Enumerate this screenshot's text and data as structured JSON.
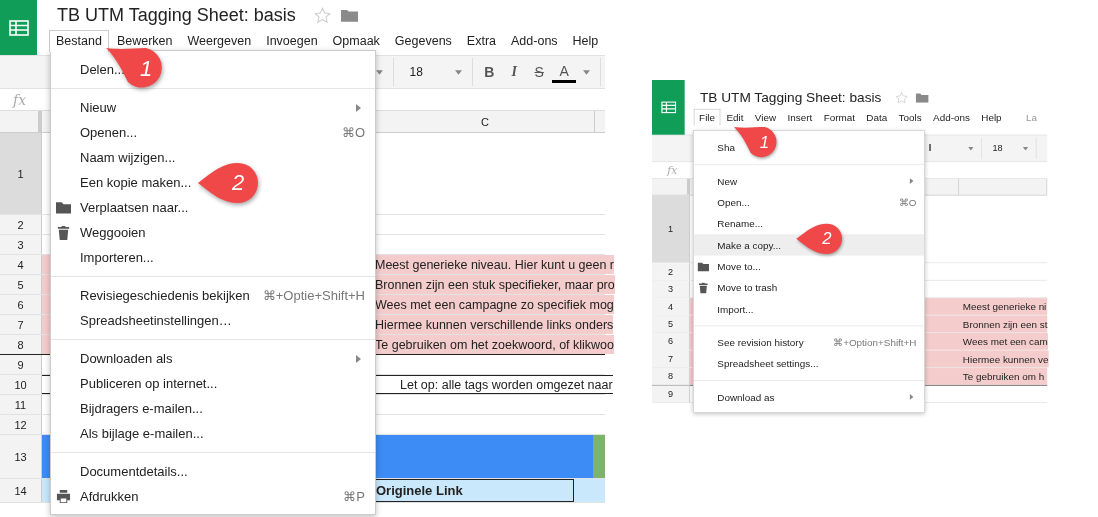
{
  "panels": [
    {
      "title": "TB UTM Tagging Sheet: basis",
      "menus": [
        {
          "label": "Bestand",
          "selected": true
        },
        {
          "label": "Bewerken",
          "selected": false
        },
        {
          "label": "Weergeven",
          "selected": false
        },
        {
          "label": "Invoegen",
          "selected": false
        },
        {
          "label": "Opmaak",
          "selected": false
        },
        {
          "label": "Gegevens",
          "selected": false
        },
        {
          "label": "Extra",
          "selected": false
        },
        {
          "label": "Add-ons",
          "selected": false
        },
        {
          "label": "Help",
          "selected": false
        }
      ],
      "toolbar": {
        "font_size": "18",
        "buttons": [
          "B",
          "I",
          "S",
          "A"
        ]
      },
      "formula_label": "fx",
      "column_label": "C",
      "rows": [
        {
          "number": "1",
          "kind": "blank"
        },
        {
          "number": "2",
          "kind": "blank"
        },
        {
          "number": "3",
          "kind": "blank"
        },
        {
          "number": "4",
          "kind": "pink",
          "text": "Meest generieke niveau. Hier kunt u geen r"
        },
        {
          "number": "5",
          "kind": "pink",
          "text": "Bronnen zijn een stuk specifieker, maar pro"
        },
        {
          "number": "6",
          "kind": "pink",
          "text": "Wees met een campagne zo specifiek mog"
        },
        {
          "number": "7",
          "kind": "pink",
          "text": "Hiermee kunnen verschillende links onders"
        },
        {
          "number": "8",
          "kind": "pink",
          "text": "Te gebruiken om het zoekwoord, of klikwoo"
        },
        {
          "number": "9",
          "kind": "blank"
        },
        {
          "number": "10",
          "kind": "note",
          "text": "Let op: alle tags worden omgezet naar"
        },
        {
          "number": "11",
          "kind": "blank"
        },
        {
          "number": "12",
          "kind": "blank"
        },
        {
          "number": "13",
          "kind": "band"
        },
        {
          "number": "14",
          "kind": "label",
          "text": "Originele Link"
        }
      ],
      "file_menu": [
        [
          {
            "label": "Delen...",
            "kind": "plain",
            "selected": false
          }
        ],
        [
          {
            "label": "Nieuw",
            "kind": "submenu",
            "selected": false
          },
          {
            "label": "Openen...",
            "kind": "plain",
            "shortcut": "⌘O",
            "selected": false
          },
          {
            "label": "Naam wijzigen...",
            "kind": "plain",
            "selected": false
          },
          {
            "label": "Een kopie maken...",
            "kind": "plain",
            "selected": false
          },
          {
            "label": "Verplaatsen naar...",
            "kind": "folder",
            "selected": false
          },
          {
            "label": "Weggooien",
            "kind": "trash",
            "selected": false
          },
          {
            "label": "Importeren...",
            "kind": "plain",
            "selected": false
          }
        ],
        [
          {
            "label": "Revisiegeschiedenis bekijken",
            "kind": "plain",
            "shortcut": "⌘+Optie+Shift+H",
            "selected": false
          },
          {
            "label": "Spreadsheetinstellingen…",
            "kind": "plain",
            "selected": false
          }
        ],
        [
          {
            "label": "Downloaden als",
            "kind": "submenu",
            "selected": false
          },
          {
            "label": "Publiceren op internet...",
            "kind": "plain",
            "selected": false
          },
          {
            "label": "Bijdragers e-mailen...",
            "kind": "plain",
            "selected": false
          },
          {
            "label": "Als bijlage e-mailen...",
            "kind": "plain",
            "selected": false
          }
        ],
        [
          {
            "label": "Documentdetails...",
            "kind": "plain",
            "selected": false
          },
          {
            "label": "Afdrukken",
            "kind": "printer",
            "shortcut": "⌘P",
            "selected": false
          }
        ]
      ],
      "callouts": [
        "1",
        "2"
      ]
    },
    {
      "title": "TB UTM Tagging Sheet: basis",
      "menus": [
        {
          "label": "File",
          "selected": true
        },
        {
          "label": "Edit",
          "selected": false
        },
        {
          "label": "View",
          "selected": false
        },
        {
          "label": "Insert",
          "selected": false
        },
        {
          "label": "Format",
          "selected": false
        },
        {
          "label": "Data",
          "selected": false
        },
        {
          "label": "Tools",
          "selected": false
        },
        {
          "label": "Add-ons",
          "selected": false
        },
        {
          "label": "Help",
          "selected": false
        }
      ],
      "last_edit": "La",
      "toolbar": {
        "font": "l",
        "font_size": "18"
      },
      "formula_label": "fx",
      "rows": [
        {
          "number": "1",
          "kind": "blank"
        },
        {
          "number": "2",
          "kind": "blank"
        },
        {
          "number": "3",
          "kind": "blank"
        },
        {
          "number": "4",
          "kind": "pink",
          "text": "Meest generieke ni"
        },
        {
          "number": "5",
          "kind": "pink",
          "text": "Bronnen zijn een st"
        },
        {
          "number": "6",
          "kind": "pink",
          "text": "Wees met een cam"
        },
        {
          "number": "7",
          "kind": "pink",
          "text": "Hiermee kunnen ve"
        },
        {
          "number": "8",
          "kind": "pink",
          "text": "Te gebruiken om h"
        },
        {
          "number": "9",
          "kind": "blank"
        }
      ],
      "file_menu": [
        [
          {
            "label": "Sha",
            "kind": "plain",
            "selected": false
          }
        ],
        [
          {
            "label": "New",
            "kind": "submenu",
            "selected": false
          },
          {
            "label": "Open...",
            "kind": "plain",
            "shortcut": "⌘O",
            "selected": false
          },
          {
            "label": "Rename...",
            "kind": "plain",
            "selected": false
          },
          {
            "label": "Make a copy...",
            "kind": "plain",
            "selected": true
          },
          {
            "label": "Move to...",
            "kind": "folder",
            "selected": false
          },
          {
            "label": "Move to trash",
            "kind": "trash",
            "selected": false
          },
          {
            "label": "Import...",
            "kind": "plain",
            "selected": false
          }
        ],
        [
          {
            "label": "See revision history",
            "kind": "plain",
            "shortcut": "⌘+Option+Shift+H",
            "selected": false
          },
          {
            "label": "Spreadsheet settings...",
            "kind": "plain",
            "selected": false
          }
        ],
        [
          {
            "label": "Download as",
            "kind": "submenu",
            "selected": false
          }
        ]
      ],
      "callouts": [
        "1",
        "2"
      ]
    }
  ]
}
